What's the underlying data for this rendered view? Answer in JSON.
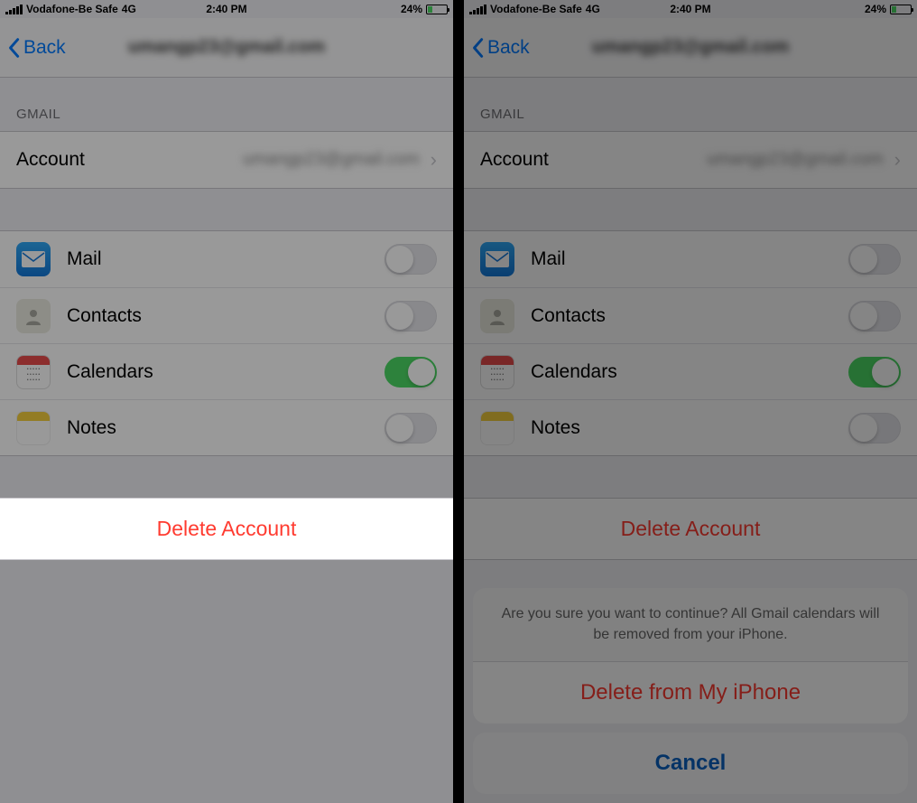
{
  "statusbar": {
    "carrier": "Vodafone-Be Safe",
    "network": "4G",
    "time": "2:40 PM",
    "battery_pct": "24%"
  },
  "nav": {
    "back": "Back",
    "title_blurred": "umangp23@gmail.com"
  },
  "sections": {
    "gmail_header": "GMAIL",
    "account_label": "Account",
    "account_value_blurred": "umangp23@gmail.com"
  },
  "toggles": {
    "mail": "Mail",
    "contacts": "Contacts",
    "calendars": "Calendars",
    "notes": "Notes"
  },
  "delete_button": "Delete Account",
  "action_sheet": {
    "message": "Are you sure you want to continue? All Gmail calendars will be removed from your iPhone.",
    "delete": "Delete from My iPhone",
    "cancel": "Cancel"
  }
}
